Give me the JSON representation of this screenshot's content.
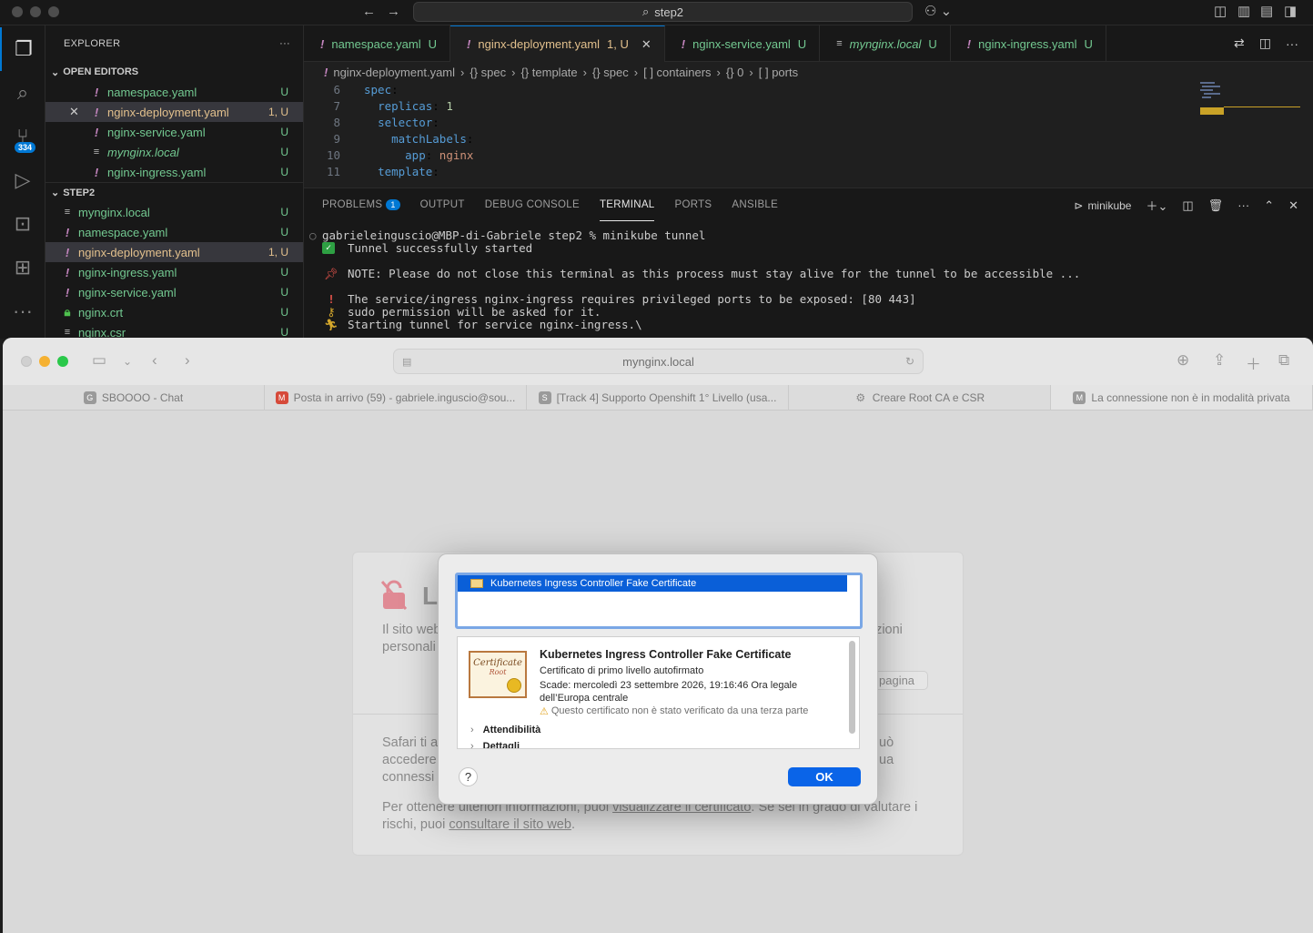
{
  "vscode": {
    "command_center": "step2",
    "activity": {
      "scm_badge": "334"
    },
    "explorer": {
      "title": "EXPLORER",
      "more": "···",
      "open_editors": {
        "title": "OPEN EDITORS",
        "items": [
          {
            "name": "namespace.yaml",
            "status": "U"
          },
          {
            "name": "nginx-deployment.yaml",
            "status": "1, U"
          },
          {
            "name": "nginx-service.yaml",
            "status": "U"
          },
          {
            "name": "mynginx.local",
            "status": "U"
          },
          {
            "name": "nginx-ingress.yaml",
            "status": "U"
          }
        ]
      },
      "folder": {
        "title": "STEP2",
        "items": [
          {
            "name": "mynginx.local",
            "status": "U"
          },
          {
            "name": "namespace.yaml",
            "status": "U"
          },
          {
            "name": "nginx-deployment.yaml",
            "status": "1, U"
          },
          {
            "name": "nginx-ingress.yaml",
            "status": "U"
          },
          {
            "name": "nginx-service.yaml",
            "status": "U"
          },
          {
            "name": "nginx.crt",
            "status": "U"
          },
          {
            "name": "nginx.csr",
            "status": "U"
          }
        ]
      }
    },
    "tabs": [
      {
        "name": "namespace.yaml",
        "status": "U"
      },
      {
        "name": "nginx-deployment.yaml",
        "status": "1, U"
      },
      {
        "name": "nginx-service.yaml",
        "status": "U"
      },
      {
        "name": "mynginx.local",
        "status": "U"
      },
      {
        "name": "nginx-ingress.yaml",
        "status": "U"
      }
    ],
    "breadcrumbs": [
      "nginx-deployment.yaml",
      "{} spec",
      "{} template",
      "{} spec",
      "[ ] containers",
      "{} 0",
      "[ ] ports"
    ],
    "code": [
      {
        "n": "6",
        "indent": "",
        "key": "spec",
        "val": ""
      },
      {
        "n": "7",
        "indent": "  ",
        "key": "replicas",
        "val": "1"
      },
      {
        "n": "8",
        "indent": "  ",
        "key": "selector",
        "val": ""
      },
      {
        "n": "9",
        "indent": "    ",
        "key": "matchLabels",
        "val": ""
      },
      {
        "n": "10",
        "indent": "      ",
        "key": "app",
        "val": "nginx"
      },
      {
        "n": "11",
        "indent": "  ",
        "key": "template",
        "val": ""
      }
    ],
    "panel": {
      "tabs": [
        "PROBLEMS",
        "OUTPUT",
        "DEBUG CONSOLE",
        "TERMINAL",
        "PORTS",
        "ANSIBLE"
      ],
      "problems_count": "1",
      "terminal_name": "minikube"
    },
    "terminal": {
      "prompt": "gabrieleinguscio@MBP-di-Gabriele step2 % minikube tunnel",
      "l1": "Tunnel successfully started",
      "l2": "NOTE: Please do not close this terminal as this process must stay alive for the tunnel to be accessible ...",
      "l3": "The service/ingress nginx-ingress requires privileged ports to be exposed: [80 443]",
      "l4": "sudo permission will be asked for it.",
      "l5": "Starting tunnel for service nginx-ingress.\\"
    }
  },
  "safari": {
    "url": "mynginx.local",
    "tabs": [
      {
        "fav": "G",
        "title": "SBOOOO - Chat"
      },
      {
        "fav": "M",
        "title": "Posta in arrivo (59) - gabriele.inguscio@sou..."
      },
      {
        "fav": "S",
        "title": "[Track 4] Supporto Openshift 1° Livello (usa..."
      },
      {
        "fav": "⚙",
        "title": "Creare Root CA e CSR"
      },
      {
        "fav": "M",
        "title": "La connessione non è in modalità privata"
      }
    ],
    "warning": {
      "title": "La",
      "p1a": "Il sito web",
      "p1b": "azioni",
      "p1c": "personali",
      "back": "pagina",
      "p2a": "Safari ti av",
      "p2b": "accedere",
      "p2c": "connessi",
      "p2d": "uò",
      "p2e": "ua",
      "p3_prefix": "Per ottenere ulteriori informazioni, puoi ",
      "p3_link1": "visualizzare il certificato",
      "p3_mid": ". Se sei in grado di valutare i",
      "p3_line2_prefix": "rischi, puoi ",
      "p3_link2": "consultare il sito web",
      "p3_suffix": "."
    }
  },
  "certificate": {
    "list_item": "Kubernetes Ingress Controller Fake Certificate",
    "name": "Kubernetes Ingress Controller Fake Certificate",
    "kind": "Certificato di primo livello autofirmato",
    "expiry1": "Scade: mercoledì 23 settembre 2026, 19:16:46 Ora legale",
    "expiry2": "dell’Europa centrale",
    "warning": "Questo certificato non è stato verificato da una terza parte",
    "trust": "Attendibilità",
    "details": "Dettagli",
    "help": "?",
    "ok": "OK",
    "img_text1": "Certificate",
    "img_text2": "Root"
  }
}
